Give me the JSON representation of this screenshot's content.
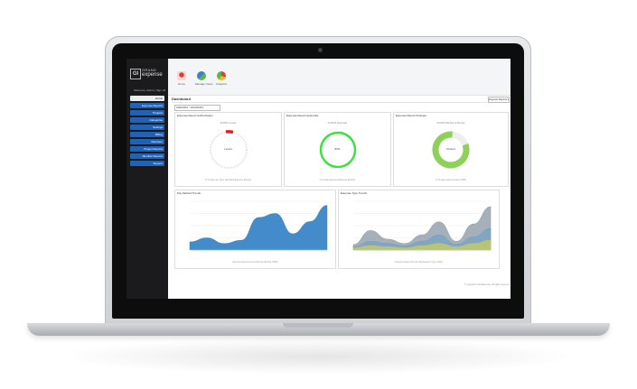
{
  "app": {
    "logo_mark": "GI",
    "logo_line1": "GRAND",
    "logo_line2": "expense",
    "welcome": "Welcome, Admin | Sign off",
    "footer": "© Copyright GrandExpense. All rights reserved."
  },
  "sidebar": {
    "items": [
      {
        "label": "Home",
        "active": true
      },
      {
        "label": "Expense Reports"
      },
      {
        "label": "Projects"
      },
      {
        "label": "Categories"
      },
      {
        "label": "Settings"
      },
      {
        "label": "Billing"
      },
      {
        "label": "Members"
      },
      {
        "label": "Project Reports"
      },
      {
        "label": "Member Reports"
      },
      {
        "label": "Support"
      }
    ]
  },
  "toolbar": {
    "items": [
      {
        "label": "Home",
        "icon": "home-icon"
      },
      {
        "label": "Manage Users",
        "icon": "users-icon"
      },
      {
        "label": "Analytics",
        "icon": "pie-icon"
      }
    ]
  },
  "dashboard": {
    "title": "Dashboard",
    "report_button": "Expense Reports ▾",
    "date_range": "01/01/2015 - 12/31/2015 ▾"
  },
  "panels": {
    "authorization": {
      "title": "Expense Report Authorization",
      "subtitle": "01/2015 Levels",
      "center": "Levels",
      "footer": "% of total user have submitted Expense Reports"
    },
    "approvals": {
      "title": "Expense Report Approvals",
      "subtitle": "01/2015 Approvals",
      "center": "80%",
      "footer": "% of total approved Expense Reports"
    },
    "postings": {
      "title": "Expense Report Postings",
      "subtitle": "01/2015 Method of Receipt",
      "center": "Posted",
      "footer": "% of total posted amount (USD)"
    },
    "pay_method": {
      "title": "Pay Method Trends",
      "footer": "Expense Report Amount By Pay Method (USD)"
    },
    "expense_type": {
      "title": "Expense Type Trends",
      "footer": "Expense Report Amount By Expense Type (USD)"
    }
  },
  "chart_data": [
    {
      "type": "pie",
      "values": [
        0.04,
        0.96
      ],
      "name": "authorization"
    },
    {
      "type": "pie",
      "values": [
        0.8,
        0.2
      ],
      "name": "approvals"
    },
    {
      "type": "pie",
      "values": [
        0.82,
        0.18
      ],
      "name": "postings"
    },
    {
      "type": "area",
      "x": [
        "2015-01",
        "2015-02",
        "2015-03",
        "2015-04",
        "2015-05",
        "2015-06",
        "2015-07",
        "2015-08",
        "2015-09"
      ],
      "series": [
        {
          "values": [
            10,
            15,
            8,
            12,
            40,
            45,
            20,
            35,
            55
          ]
        }
      ],
      "ylim": [
        0,
        60
      ]
    },
    {
      "type": "area",
      "x": [
        "2015-01",
        "2015-02",
        "2015-03",
        "2015-04",
        "2015-05",
        "2015-06",
        "2015-07",
        "2015-08",
        "2015-09"
      ],
      "series": [
        {
          "values": [
            5,
            18,
            10,
            6,
            14,
            26,
            8,
            24,
            40
          ]
        },
        {
          "values": [
            3,
            8,
            6,
            4,
            8,
            14,
            5,
            12,
            20
          ]
        },
        {
          "values": [
            2,
            4,
            3,
            2,
            4,
            6,
            3,
            6,
            9
          ]
        }
      ],
      "ylim": [
        0,
        45
      ]
    }
  ],
  "colors": {
    "accent": "#1e63b8",
    "green": "#3fe043",
    "ring_green": "#8fd05a",
    "area_blue": "#3a85c8",
    "area_grey": "#8896a4",
    "area_olive": "#bcc86d"
  }
}
